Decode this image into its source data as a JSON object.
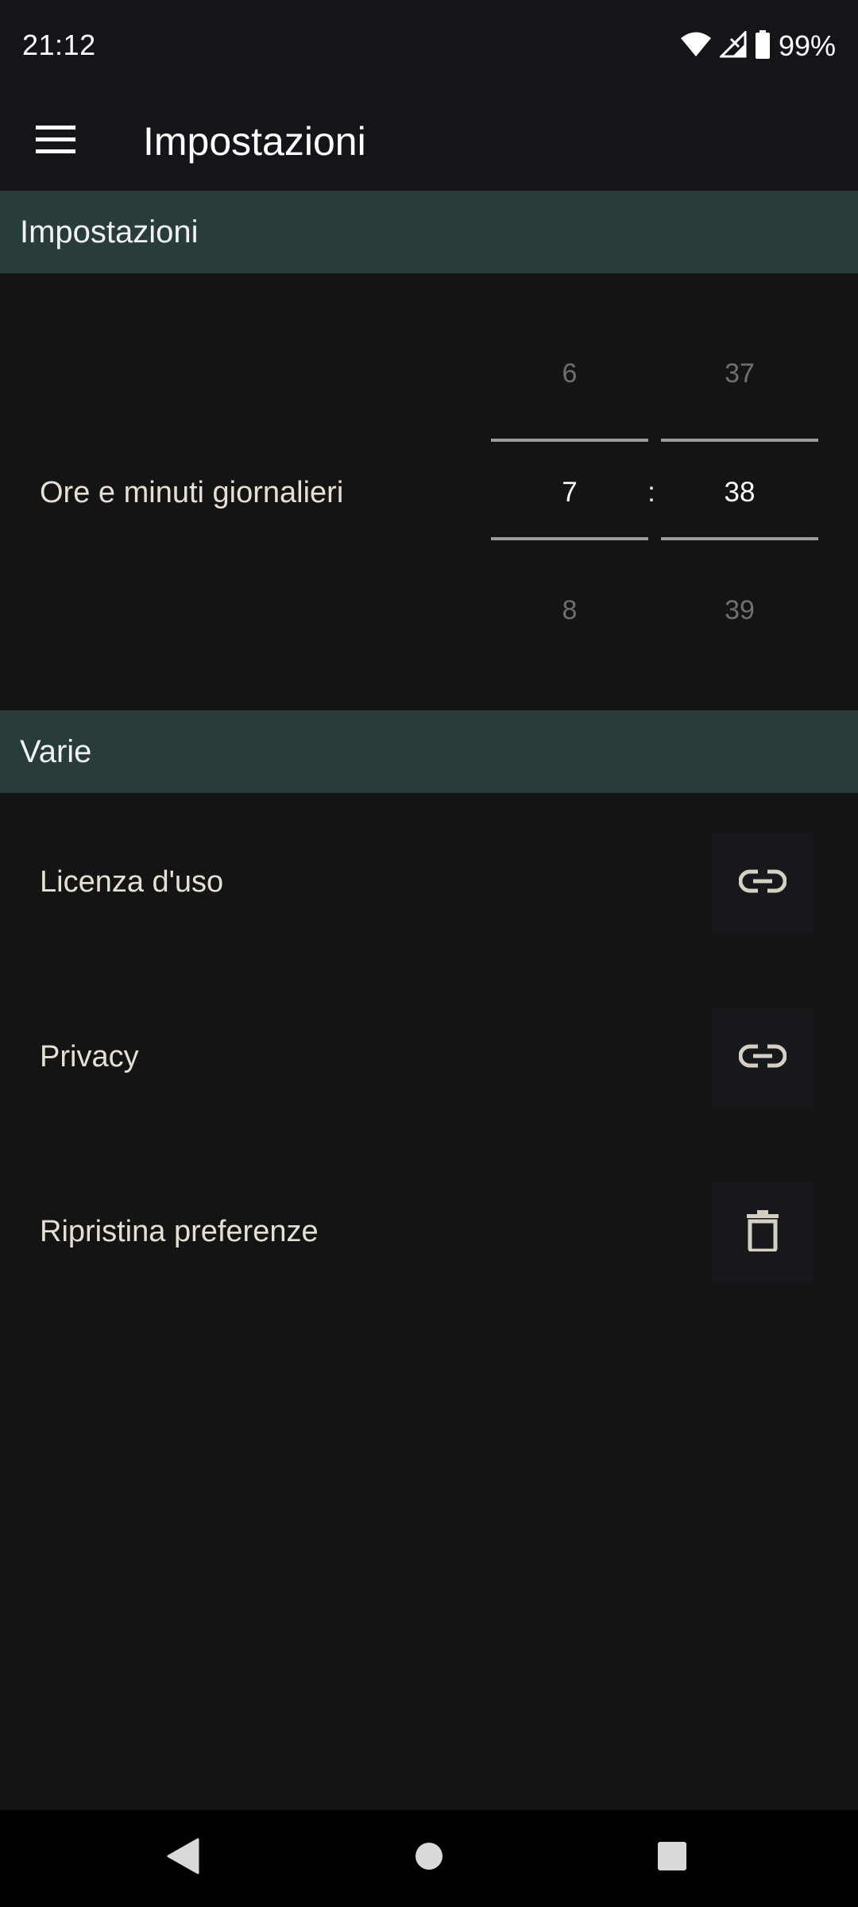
{
  "status_bar": {
    "time": "21:12",
    "battery": "99%",
    "icons": [
      "wifi-icon",
      "signal-icon",
      "battery-icon"
    ]
  },
  "app_bar": {
    "title": "Impostazioni",
    "menu_icon": "hamburger-menu-icon"
  },
  "sections": {
    "settings_header": "Impostazioni",
    "misc_header": "Varie"
  },
  "time_setting": {
    "label": "Ore e minuti giornalieri",
    "hours": {
      "prev": "6",
      "current": "7",
      "next": "8"
    },
    "separator": ":",
    "minutes": {
      "prev": "37",
      "current": "38",
      "next": "39"
    }
  },
  "misc_items": [
    {
      "label": "Licenza d'uso",
      "icon": "link-icon"
    },
    {
      "label": "Privacy",
      "icon": "link-icon"
    },
    {
      "label": "Ripristina preferenze",
      "icon": "trash-icon"
    }
  ],
  "nav_bar": {
    "icons": [
      "back-icon",
      "home-icon",
      "recents-icon"
    ]
  },
  "colors": {
    "background": "#141414",
    "bar_background": "#141518",
    "section_header": "#283d3b",
    "text": "#e6dfd4",
    "muted_picker_text": "#6f6f6f"
  }
}
